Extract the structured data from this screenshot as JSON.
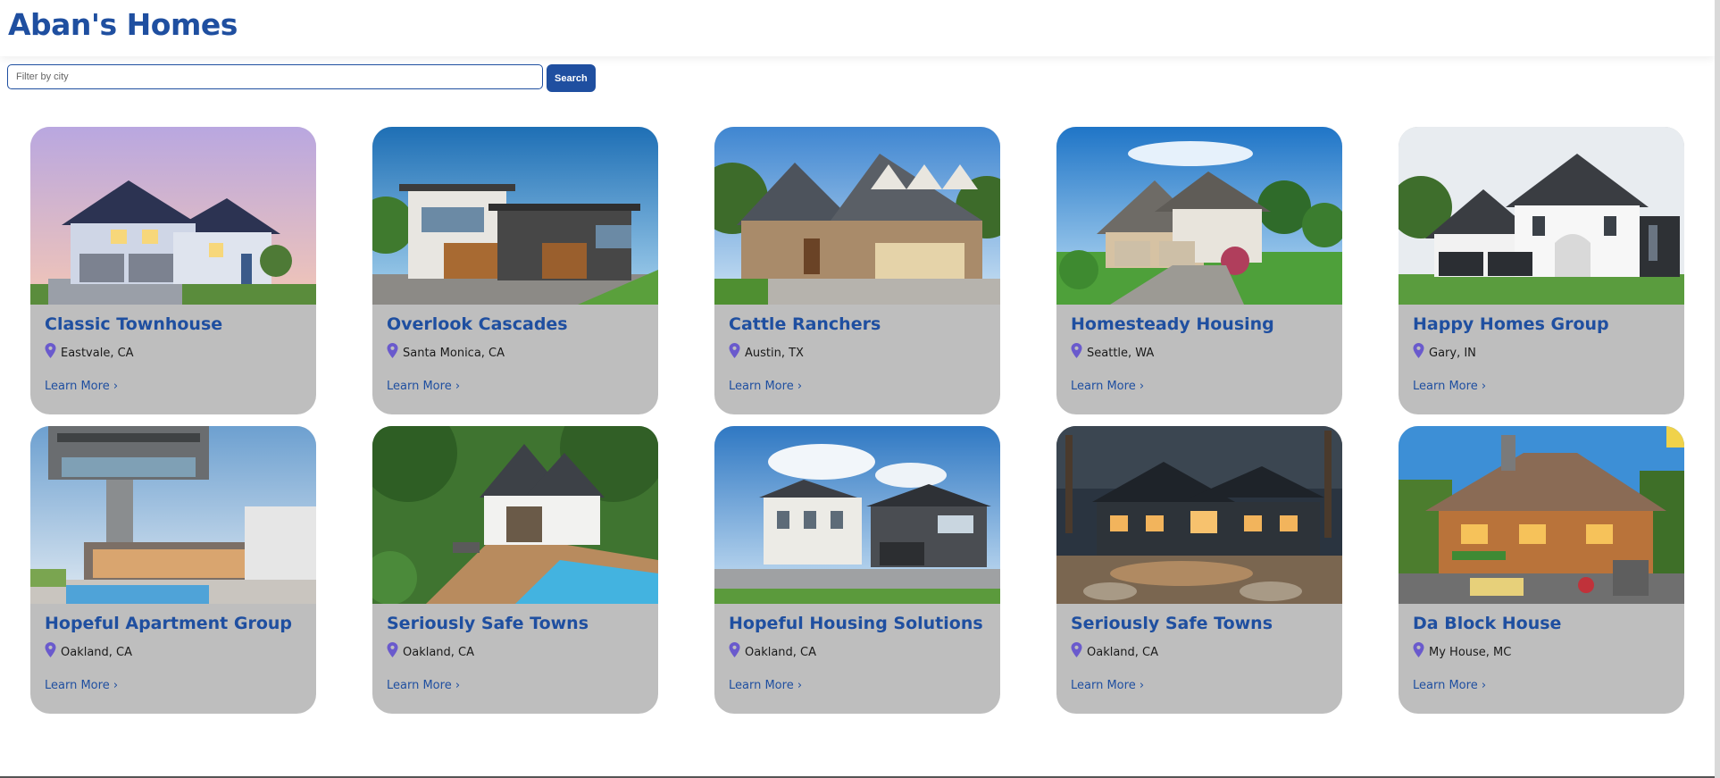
{
  "app": {
    "title": "Aban's Homes"
  },
  "search": {
    "placeholder": "Filter by city",
    "value": "",
    "button_label": "Search"
  },
  "cards": [
    {
      "title": "Classic Townhouse",
      "city": "Eastvale, CA",
      "link": "Learn More ›",
      "scene": "townhouse"
    },
    {
      "title": "Overlook Cascades",
      "city": "Santa Monica, CA",
      "link": "Learn More ›",
      "scene": "modern"
    },
    {
      "title": "Cattle Ranchers",
      "city": "Austin, TX",
      "link": "Learn More ›",
      "scene": "stone"
    },
    {
      "title": "Homesteady Housing",
      "city": "Seattle, WA",
      "link": "Learn More ›",
      "scene": "suburban"
    },
    {
      "title": "Happy Homes Group",
      "city": "Gary, IN",
      "link": "Learn More ›",
      "scene": "farmhouse"
    },
    {
      "title": "Hopeful Apartment Group",
      "city": "Oakland, CA",
      "link": "Learn More ›",
      "scene": "cantilever"
    },
    {
      "title": "Seriously Safe Towns",
      "city": "Oakland, CA",
      "link": "Learn More ›",
      "scene": "pool"
    },
    {
      "title": "Hopeful Housing Solutions",
      "city": "Oakland, CA",
      "link": "Learn More ›",
      "scene": "mansions"
    },
    {
      "title": "Seriously Safe Towns",
      "city": "Oakland, CA",
      "link": "Learn More ›",
      "scene": "night"
    },
    {
      "title": "Da Block House",
      "city": "My House, MC",
      "link": "Learn More ›",
      "scene": "blocky"
    }
  ],
  "colors": {
    "accent": "#1f4fa0",
    "card_bg": "#bebebe",
    "pin": "#6a5acd"
  },
  "icons": {
    "location": "map-pin-icon"
  }
}
